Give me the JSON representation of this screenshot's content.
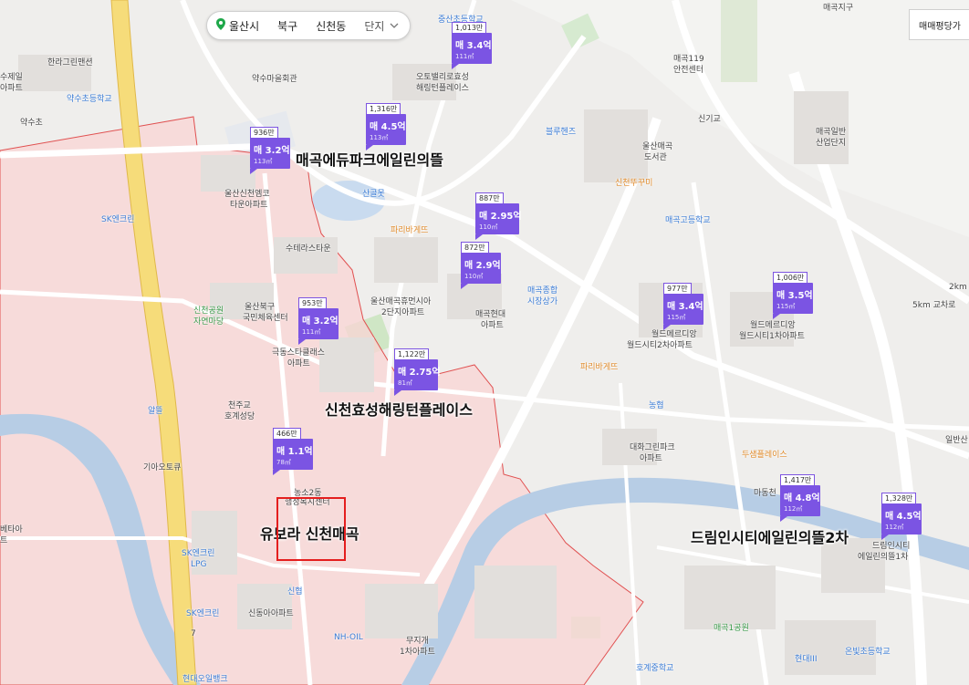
{
  "breadcrumb": {
    "city": "울산시",
    "district": "북구",
    "dong": "신천동",
    "complex": "단지"
  },
  "trade_type": "매매평당가",
  "markers": [
    {
      "count": "1,013만",
      "price": "매 3.4억",
      "area": "111㎡"
    },
    {
      "count": "1,316만",
      "price": "매 4.5억",
      "area": "113㎡"
    },
    {
      "count": "936만",
      "price": "매 3.2억",
      "area": "113㎡"
    },
    {
      "count": "887만",
      "price": "매 2.95억",
      "area": "110㎡"
    },
    {
      "count": "872만",
      "price": "매 2.9억",
      "area": "110㎡"
    },
    {
      "count": "953만",
      "price": "매 3.2억",
      "area": "111㎡"
    },
    {
      "count": "1,122만",
      "price": "매 2.75억",
      "area": "81㎡"
    },
    {
      "count": "466만",
      "price": "매 1.1억",
      "area": "78㎡"
    },
    {
      "count": "977만",
      "price": "매 3.4억",
      "area": "115㎡"
    },
    {
      "count": "1,006만",
      "price": "매 3.5억",
      "area": "115㎡"
    },
    {
      "count": "1,417만",
      "price": "매 4.8억",
      "area": "112㎡"
    },
    {
      "count": "1,328만",
      "price": "매 4.5억",
      "area": "112㎡"
    }
  ],
  "complex_names": [
    "매곡에듀파크에일린의뜰",
    "신천효성해링턴플레이스",
    "유보라 신천매곡",
    "드림인시티에일린의뜰2차"
  ],
  "places": [
    "한라그린맨션",
    "수제일",
    "아파트",
    "약수초등학교",
    "약수마을회관",
    "약수초",
    "오토밸리로효성",
    "해링턴플레이스",
    "중산초등학교",
    "매곡119",
    "안전센터",
    "매곡지구",
    "신기교",
    "매곡일반",
    "산업단지",
    "울산매곡",
    "도서관",
    "블루헨즈",
    "산골못",
    "신천뚜꾸미",
    "매곡고등학교",
    "파리바게뜨",
    "울산신천엠코",
    "타운아파트",
    "SK엔크린",
    "수테라스타운",
    "울산북구",
    "국민체육센터",
    "신천공원",
    "자연마당",
    "울산매곡휴먼시아",
    "2단지아파트",
    "매곡현대",
    "아파트",
    "매곡종합",
    "시장상가",
    "월드메르디앙",
    "월드시티2차아파트",
    "월드메르디앙",
    "월드시티1차아파트",
    "극동스타클래스",
    "아파트",
    "천주교",
    "호계성당",
    "알뜰",
    "기아오토큐",
    "파리바게뜨",
    "농협",
    "대화그린파크",
    "아파트",
    "두샘플레이스",
    "농소2동",
    "행정복지센터",
    "SK엔크린",
    "LPG",
    "신협",
    "SK엔크린",
    "신동아아파트",
    "NH-OIL",
    "무지개",
    "1차아파트",
    "현대오일뱅크",
    "마동천",
    "드림인시티",
    "에일린의뜰1차",
    "매곡1공원",
    "호계중학교",
    "현대III",
    "온빛초등학교",
    "2km",
    "일반산",
    "5km 교차로",
    "7",
    "베타아",
    "트"
  ]
}
